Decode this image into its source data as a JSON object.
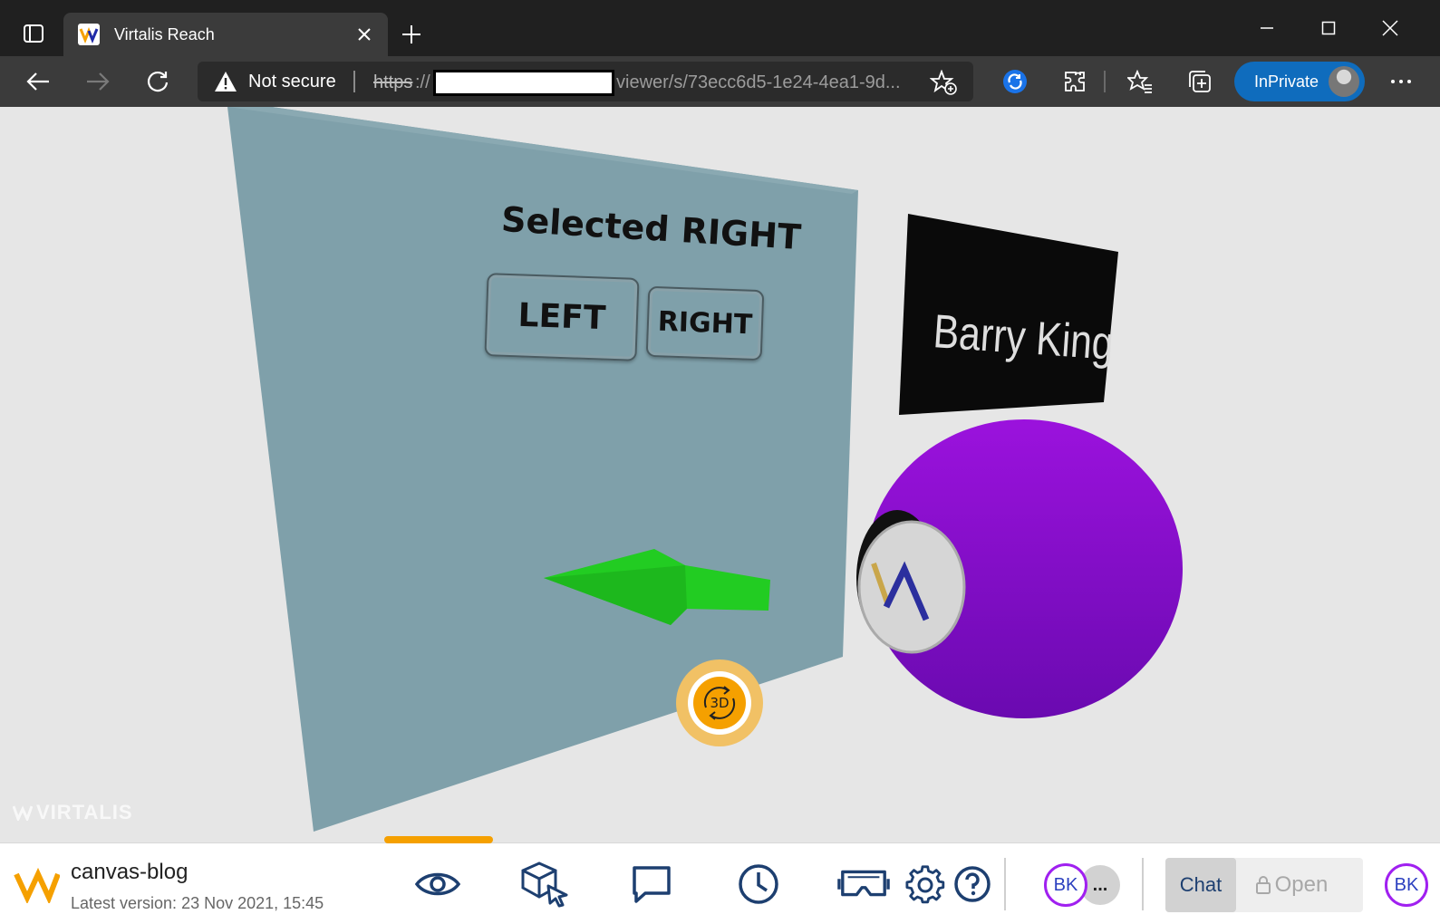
{
  "browser": {
    "tab_title": "Virtalis Reach",
    "security_label": "Not secure",
    "url_scheme": "https",
    "url_separator": "://",
    "url_path": "viewer/s/73ecc6d5-1e24-4ea1-9d...",
    "inprivate_label": "InPrivate",
    "icons": [
      "tab-actions-icon",
      "close-icon",
      "plus-icon",
      "minimize-icon",
      "maximize-icon",
      "close-window-icon",
      "back-icon",
      "forward-icon",
      "refresh-icon",
      "warning-icon",
      "add-favorite-icon",
      "sync-icon",
      "extensions-icon",
      "favorites-icon",
      "collections-icon",
      "more-icon"
    ]
  },
  "scene": {
    "panel_heading": "Selected RIGHT",
    "left_button": "LEFT",
    "right_button": "RIGHT",
    "avatar_name": "Barry King",
    "rotate_mode_label": "3D",
    "watermark": "VIRTALIS",
    "colors": {
      "background": "#e6e6e6",
      "panel": "#7fa0aa",
      "arrow": "#22cc22",
      "avatar_body": "#8a10d0",
      "name_tag": "#0a0a0a",
      "accent": "#f5a000"
    }
  },
  "bottombar": {
    "project_name": "canvas-blog",
    "version": "Latest version: 23 Nov 2021, 15:45",
    "nav_icons": [
      "eye-icon",
      "cube-select-icon",
      "comment-icon",
      "clock-icon",
      "vr-headset-icon",
      "gear-icon",
      "help-icon"
    ],
    "active_nav": "eye-icon",
    "user_initials": "BK",
    "more_users": "...",
    "chat_label": "Chat",
    "open_label": "Open",
    "me_initials": "BK",
    "accent_color": "#f5a000",
    "user_ring_color": "#a020f0"
  }
}
